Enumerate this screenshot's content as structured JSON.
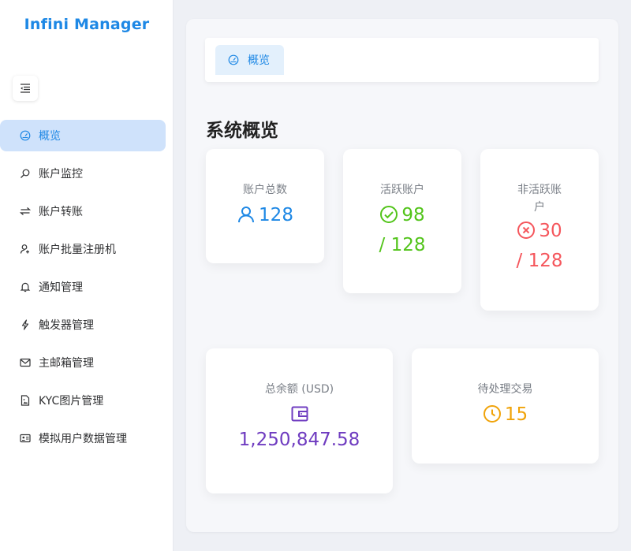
{
  "app": {
    "title": "Infini Manager"
  },
  "sidebar": {
    "items": [
      {
        "label": "概览",
        "icon": "dashboard-icon",
        "active": true
      },
      {
        "label": "账户监控",
        "icon": "search-icon"
      },
      {
        "label": "账户转账",
        "icon": "transfer-icon"
      },
      {
        "label": "账户批量注册机",
        "icon": "user-add-icon"
      },
      {
        "label": "通知管理",
        "icon": "bell-icon"
      },
      {
        "label": "触发器管理",
        "icon": "lightning-icon"
      },
      {
        "label": "主邮箱管理",
        "icon": "mail-icon"
      },
      {
        "label": "KYC图片管理",
        "icon": "file-image-icon"
      },
      {
        "label": "模拟用户数据管理",
        "icon": "id-card-icon"
      }
    ]
  },
  "tabs": [
    {
      "label": "概览",
      "icon": "dashboard-icon"
    }
  ],
  "page": {
    "title": "系统概览"
  },
  "stats": {
    "total_accounts": {
      "label": "账户总数",
      "value": "128",
      "icon": "user-icon"
    },
    "active_accounts": {
      "label": "活跃账户",
      "value": "98",
      "suffix": "/ 128",
      "icon": "check-circle-icon"
    },
    "inactive_accounts": {
      "label_line1": "非活跃账",
      "label_line2": "户",
      "value": "30",
      "suffix": "/ 128",
      "icon": "close-circle-icon"
    },
    "total_balance": {
      "label": "总余额 (USD)",
      "value": "1,250,847.58",
      "icon": "wallet-icon"
    },
    "pending_transactions": {
      "label": "待处理交易",
      "value": "15",
      "icon": "clock-icon"
    }
  },
  "colors": {
    "accent": "#1e88e5",
    "success": "#52c41a",
    "danger": "#f5565c",
    "purple": "#6f3cc0",
    "warning": "#f0a30a"
  }
}
